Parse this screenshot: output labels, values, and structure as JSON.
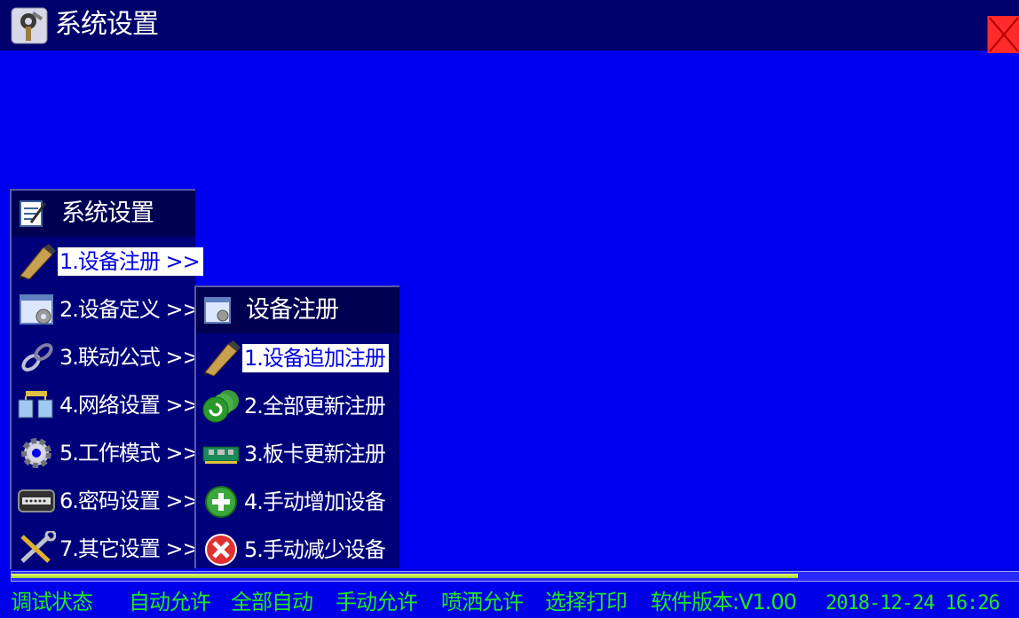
{
  "window": {
    "title": "系统设置",
    "icons": {
      "app": "settings-tools-icon",
      "close": "close-x-icon"
    },
    "colors": {
      "background": "#0000f0",
      "titlebar": "#00006b",
      "close": "#ff2a2a"
    }
  },
  "main_menu": {
    "header": "系统设置",
    "header_icon": "notepad-icon",
    "items": [
      {
        "label": "1.设备注册 >>",
        "icon": "pencil-icon",
        "selected": true
      },
      {
        "label": "2.设备定义 >>",
        "icon": "gear-window-icon",
        "selected": false
      },
      {
        "label": "3.联动公式 >>",
        "icon": "chain-link-icon",
        "selected": false
      },
      {
        "label": "4.网络设置 >>",
        "icon": "network-computers-icon",
        "selected": false
      },
      {
        "label": "5.工作模式 >>",
        "icon": "gear-icon",
        "selected": false
      },
      {
        "label": "6.密码设置 >>",
        "icon": "password-keypad-icon",
        "selected": false
      },
      {
        "label": "7.其它设置 >>",
        "icon": "tools-icon",
        "selected": false
      }
    ]
  },
  "sub_menu": {
    "header": "设备注册",
    "header_icon": "gear-window-icon",
    "items": [
      {
        "label": "1.设备追加注册",
        "icon": "pencil-icon",
        "selected": true
      },
      {
        "label": "2.全部更新注册",
        "icon": "refresh-discs-icon",
        "selected": false
      },
      {
        "label": "3.板卡更新注册",
        "icon": "circuit-board-icon",
        "selected": false
      },
      {
        "label": "4.手动增加设备",
        "icon": "add-circle-icon",
        "selected": false
      },
      {
        "label": "5.手动减少设备",
        "icon": "remove-circle-icon",
        "selected": false
      }
    ]
  },
  "progress": {
    "fraction": 0.78
  },
  "status_bar": {
    "items": [
      "调试状态",
      "自动允许",
      "全部自动",
      "手动允许",
      "喷洒允许",
      "选择打印"
    ],
    "version": "软件版本:V1.00",
    "datetime": "2018-12-24 16:26",
    "color": "#22e622"
  }
}
